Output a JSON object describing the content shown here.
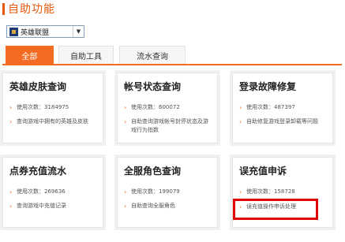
{
  "header": {
    "title": "自助功能"
  },
  "game_select": {
    "value": "英雄联盟",
    "logo_icon": "game-logo-icon",
    "arrow_icon": "chevron-down-icon"
  },
  "tabs": [
    {
      "label": "全部",
      "active": true
    },
    {
      "label": "自助工具",
      "active": false
    },
    {
      "label": "流水查询",
      "active": false
    }
  ],
  "cards": [
    {
      "title": "英雄皮肤查询",
      "lines": [
        "使用次数：3184975",
        "查询游戏中拥有的英雄及皮肤"
      ]
    },
    {
      "title": "帐号状态查询",
      "lines": [
        "使用次数：600072",
        "自助查询游戏帐号封停状态及游戏行为指数"
      ]
    },
    {
      "title": "登录故障修复",
      "lines": [
        "使用次数：487397",
        "自助修复游戏登录卸载等问题"
      ]
    },
    {
      "title": "点券充值流水",
      "lines": [
        "使用次数：269636",
        "查询游戏中充值记录"
      ]
    },
    {
      "title": "全服角色查询",
      "lines": [
        "使用次数：199079",
        "自助查询全服角色"
      ]
    },
    {
      "title": "误充值申诉",
      "lines": [
        "使用次数：158728",
        "误充值操作申诉处理"
      ]
    }
  ],
  "colors": {
    "accent": "#f36c21",
    "highlight": "#e00000"
  }
}
